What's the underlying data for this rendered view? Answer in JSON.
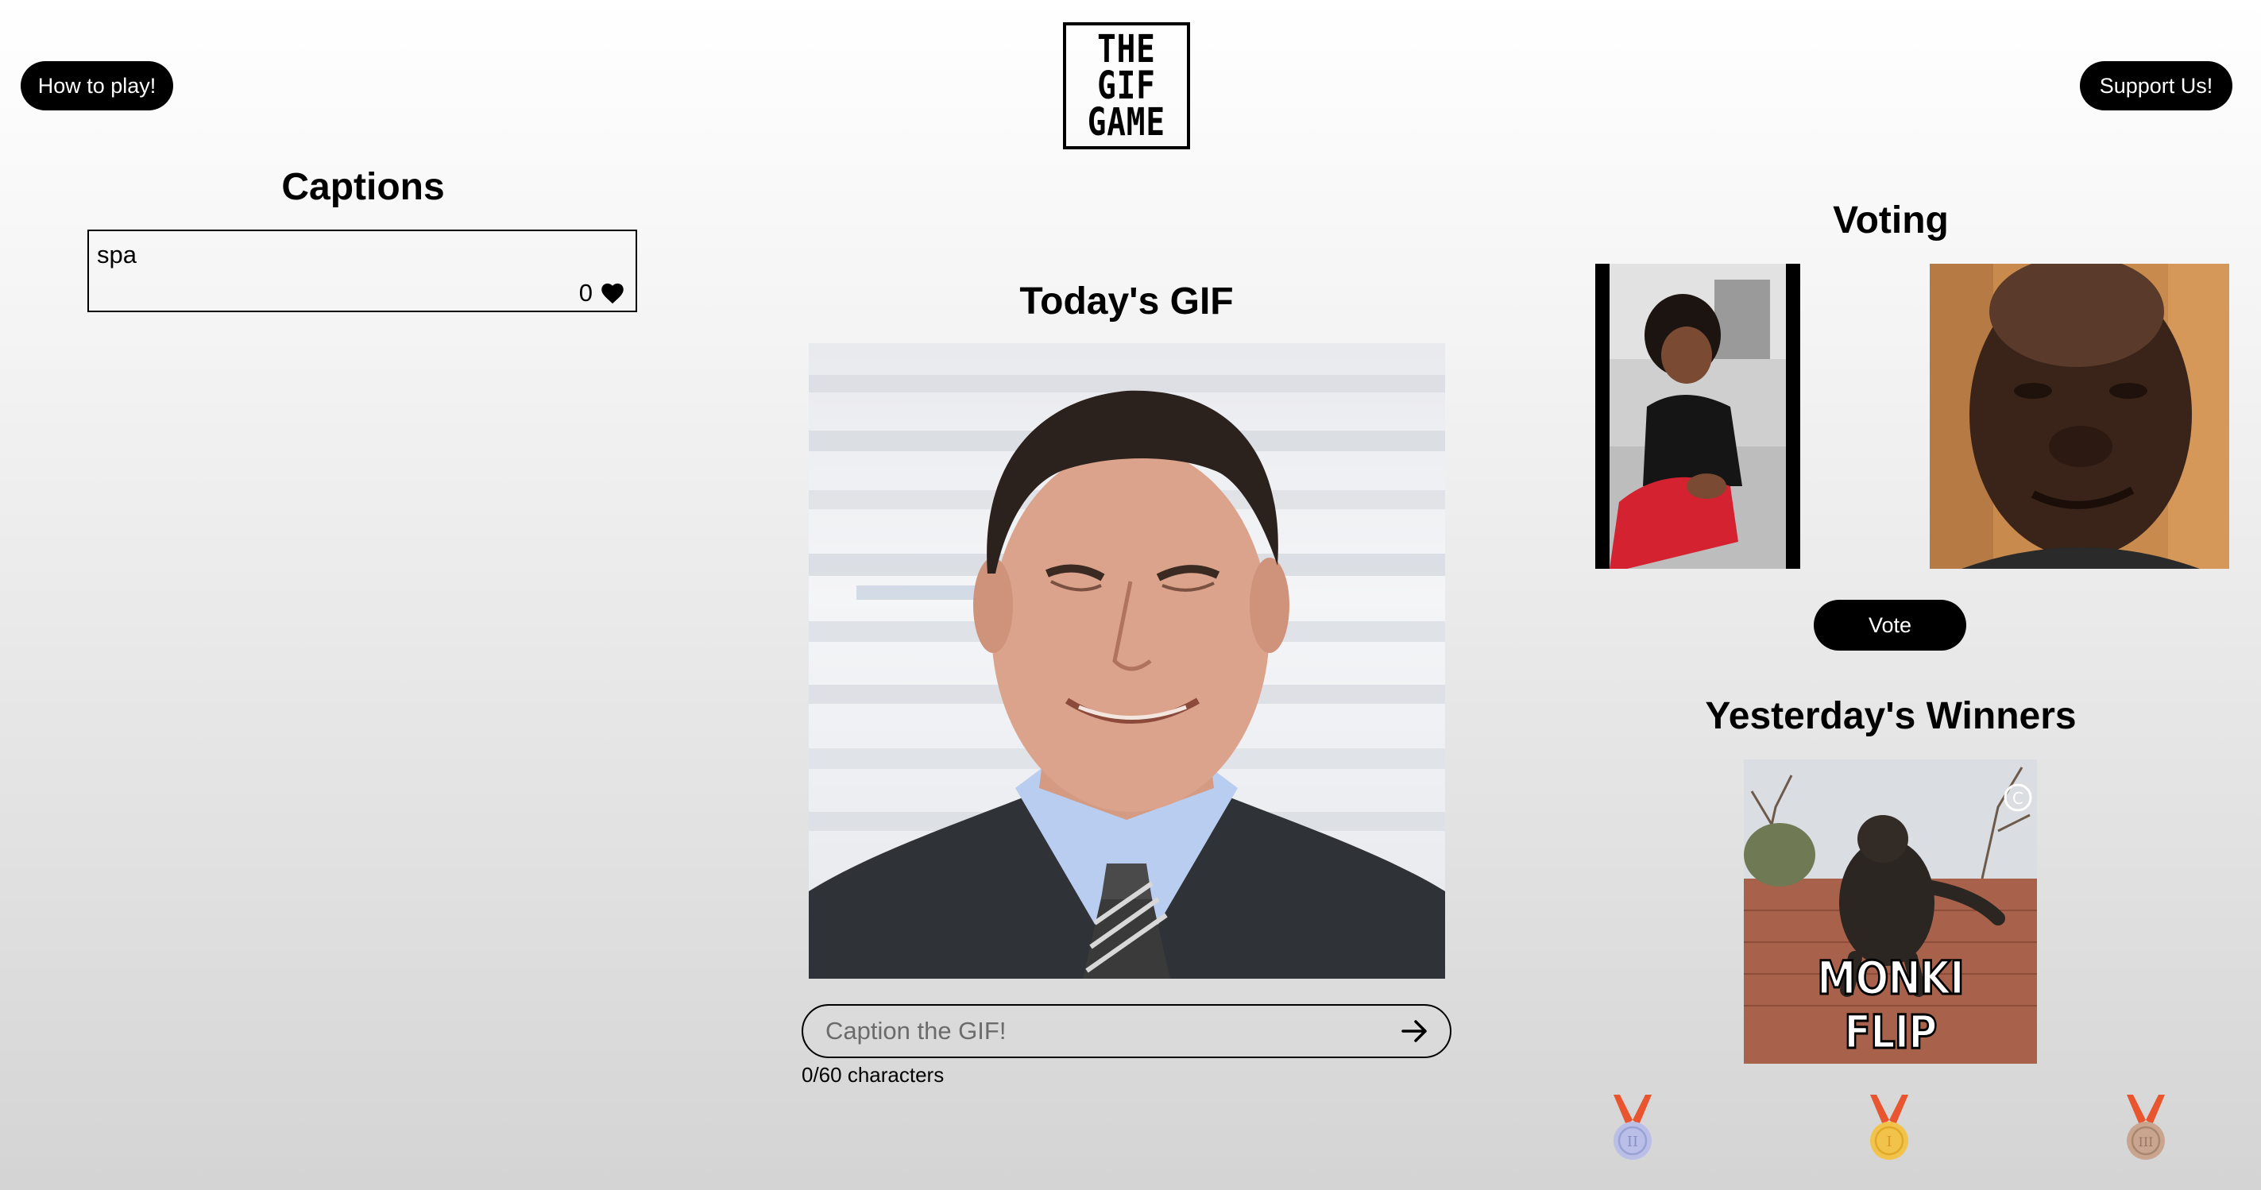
{
  "header": {
    "how_to_play_label": "How to play!",
    "support_label": "Support Us!",
    "logo_lines": [
      "THE",
      "GIF",
      "GAME"
    ]
  },
  "captions": {
    "title": "Captions",
    "items": [
      {
        "text": "spa",
        "likes": "0"
      }
    ]
  },
  "today": {
    "title": "Today's GIF",
    "input_placeholder": "Caption the GIF!",
    "input_value": "",
    "char_count": "0/60 characters"
  },
  "voting": {
    "title": "Voting",
    "vote_label": "Vote"
  },
  "winners": {
    "title": "Yesterday's Winners",
    "gif_caption": "MONKI FLIP",
    "medals": [
      {
        "name": "silver-medal",
        "numeral": "II",
        "color": "#b9bfe6"
      },
      {
        "name": "gold-medal",
        "numeral": "I",
        "color": "#f2c34a"
      },
      {
        "name": "bronze-medal",
        "numeral": "III",
        "color": "#c9a58f"
      }
    ]
  },
  "colors": {
    "accent": "#000000",
    "ribbon": "#e8552f"
  }
}
